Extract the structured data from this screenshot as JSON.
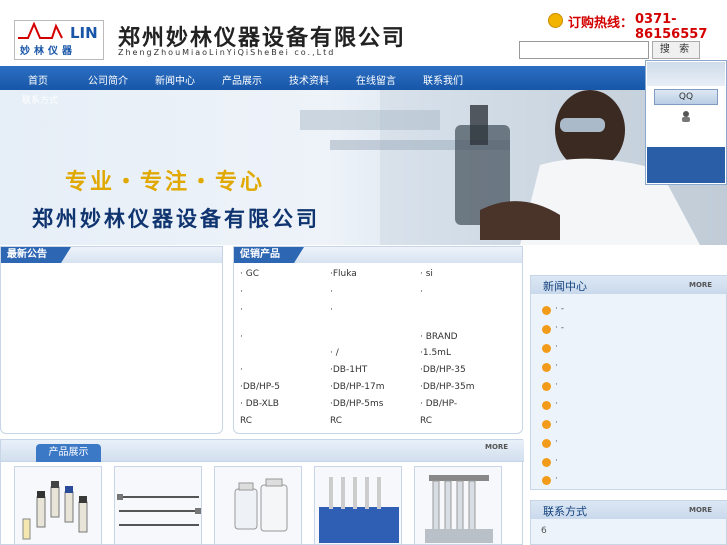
{
  "header": {
    "logo_text": "LIN",
    "logo_caption": "妙林仪器",
    "company_cn": "郑州妙林仪器设备有限公司",
    "company_en": "ZhengZhouMiaoLinYiQiSheBei co.,Ltd",
    "hotline_label": "订购热线：",
    "hotline_number": "0371-86156557",
    "search_placeholder": "",
    "search_button": "搜 索"
  },
  "nav": {
    "items": [
      "首页",
      "公司简介",
      "新闻中心",
      "产品展示",
      "技术资料",
      "在线留言",
      "联系我们"
    ],
    "sub_item": "联系方式"
  },
  "banner": {
    "slogan": "专业・专注・专心",
    "company": "郑州妙林仪器设备有限公司"
  },
  "qq": {
    "button": "QQ"
  },
  "notice": {
    "title": "最新公告"
  },
  "promo": {
    "title": "促销产品",
    "cells": [
      [
        "·  GC",
        "·Fluka",
        "·     si"
      ],
      [
        "·",
        "·",
        "·"
      ],
      [
        "·",
        "·",
        "·  BRAND"
      ],
      [
        "·",
        "·   /",
        "·1.5mL"
      ],
      [
        "·",
        "·DB-1HT",
        "·DB/HP-35"
      ],
      [
        "·DB/HP-5",
        "·DB/HP-17m",
        "·DB/HP-35m"
      ],
      [
        "·  DB-XLB",
        "·DB/HP-5ms",
        "·  DB/HP-"
      ],
      [
        "RC",
        "RC",
        "RC"
      ]
    ]
  },
  "products": {
    "title": "产品展示",
    "more": "MORE"
  },
  "news": {
    "title": "新闻中心",
    "more": "MORE",
    "items": [
      "·  -",
      "·  -",
      "·",
      "·",
      "·",
      "·",
      "·",
      "·",
      "·",
      "·"
    ]
  },
  "contact": {
    "title": "联系方式",
    "more": "MORE",
    "line": "6"
  },
  "colors": {
    "nav_blue": "#1f62b4",
    "hotline_red": "#d40000",
    "slogan_gold": "#e0a800"
  }
}
